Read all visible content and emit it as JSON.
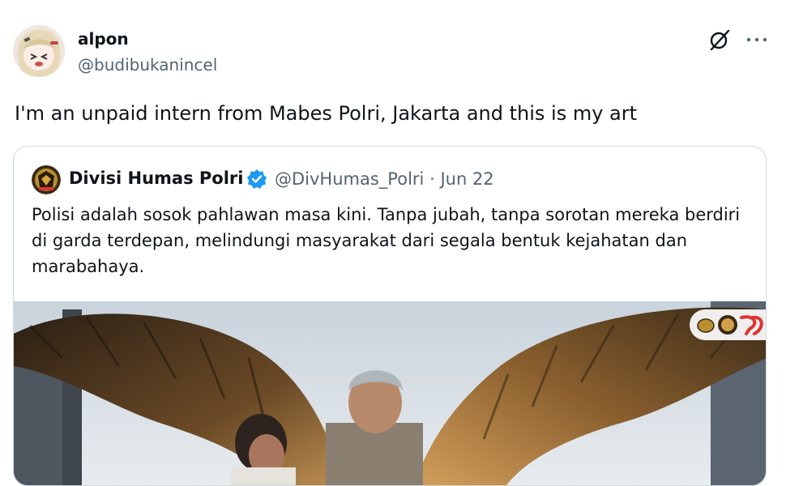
{
  "tweet": {
    "author_name": "alpon",
    "author_handle": "@budibukanincel",
    "text": "I'm an unpaid intern from Mabes Polri, Jakarta and this is my art",
    "actions": {
      "grok_icon": "grok-slash-icon",
      "more_icon": "more-dots-icon",
      "more_label": "···"
    }
  },
  "quoted_tweet": {
    "author_name": "Divisi Humas Polri",
    "verified_icon": "verified-badge-icon",
    "author_handle": "@DivHumas_Polri",
    "separator": "·",
    "date": "Jun 22",
    "text": "Polisi adalah sosok pahlawan masa kini. Tanpa jubah, tanpa sorotan mereka berdiri di garda terdepan, melindungi masyarakat dari segala bentuk kejahatan dan marabahaya.",
    "media_description_icon": "angel-wings-police-image"
  },
  "colors": {
    "text": "#0f1419",
    "secondary": "#536471",
    "border": "#cfd9de",
    "verified": "#1d9bf0"
  }
}
